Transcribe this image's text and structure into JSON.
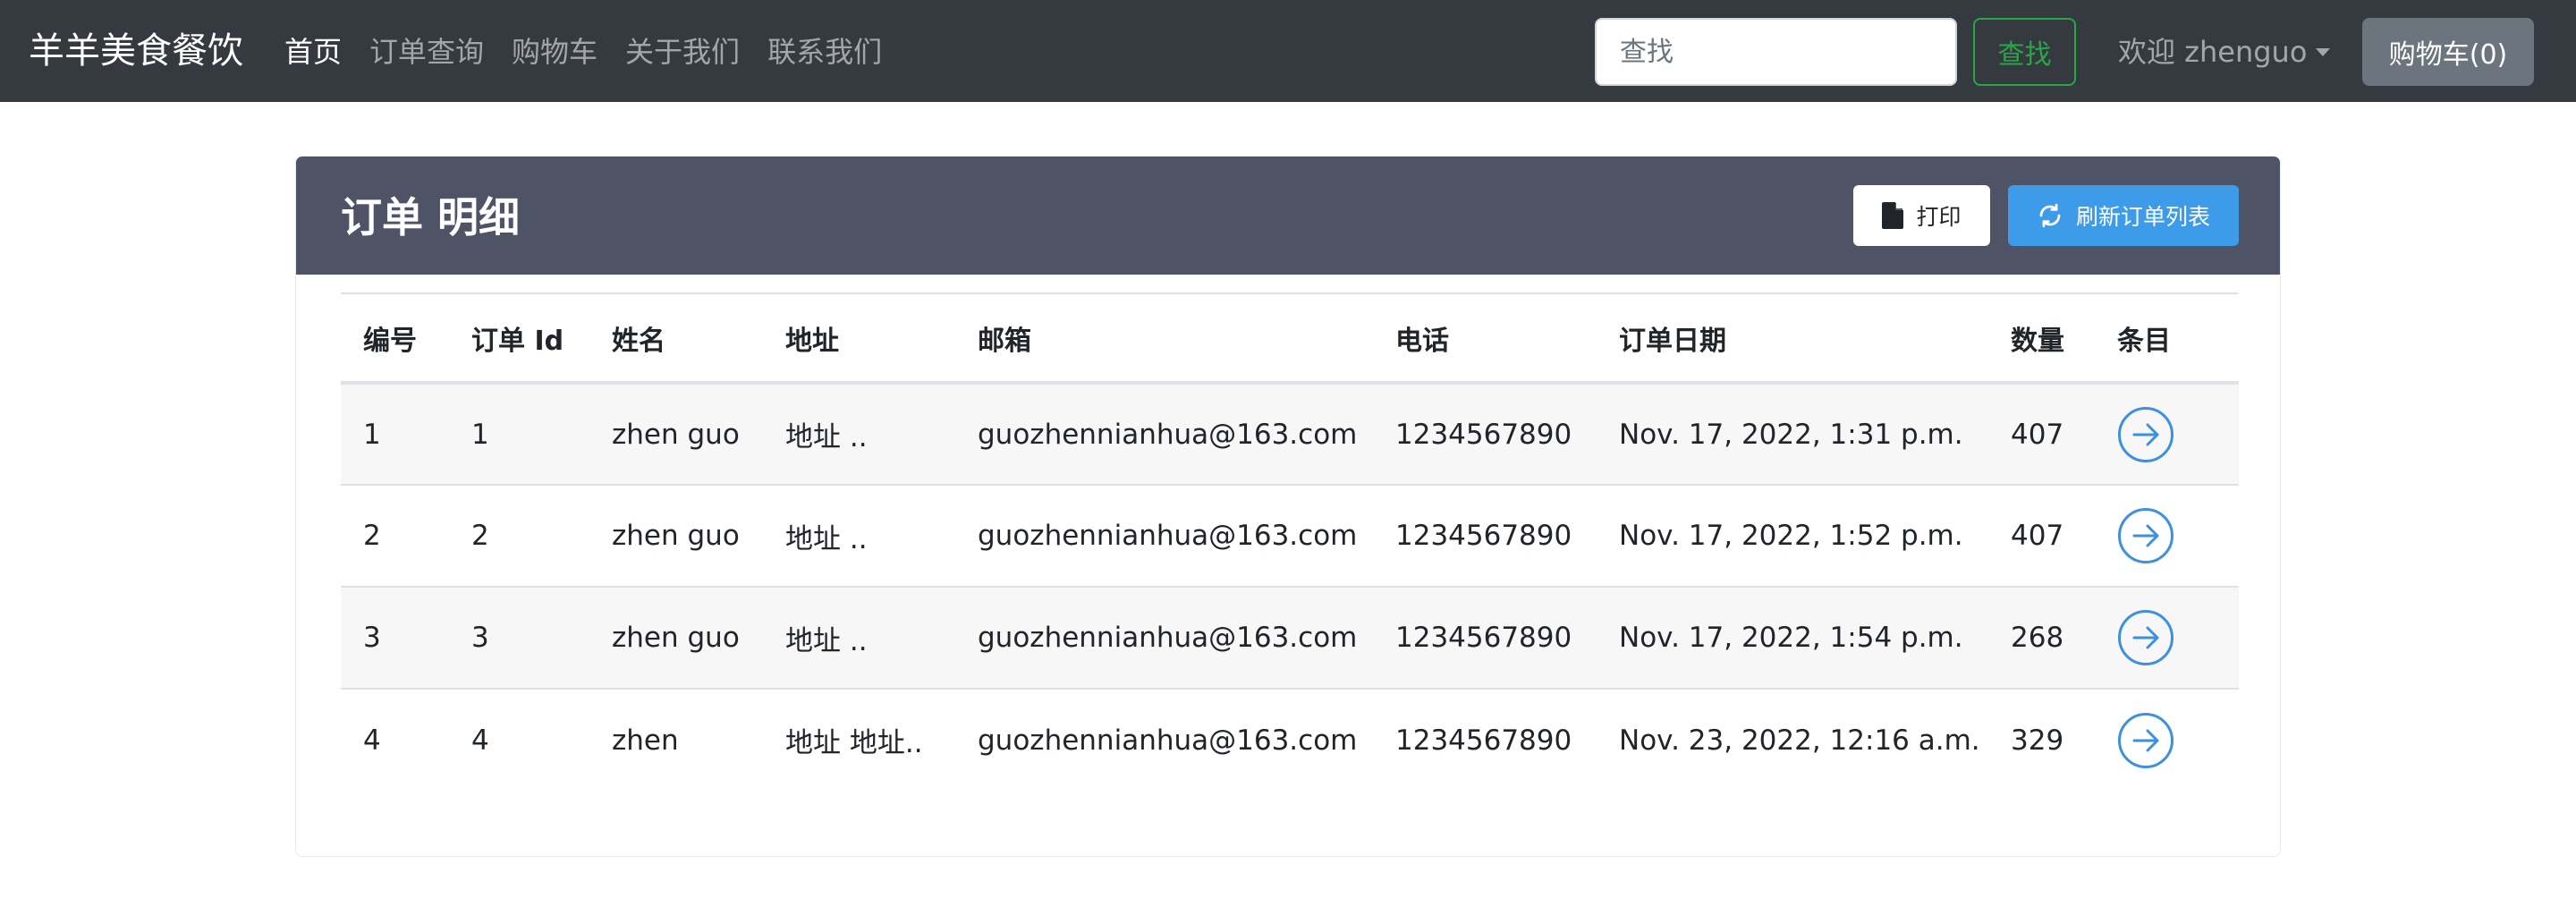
{
  "navbar": {
    "brand": "羊羊美食餐饮",
    "links": [
      {
        "label": "首页",
        "active": true
      },
      {
        "label": "订单查询",
        "active": false
      },
      {
        "label": "购物车",
        "active": false
      },
      {
        "label": "关于我们",
        "active": false
      },
      {
        "label": "联系我们",
        "active": false
      }
    ],
    "search_placeholder": "查找",
    "search_button": "查找",
    "user_label": "欢迎 zhenguo",
    "cart_button": "购物车(0)"
  },
  "card": {
    "title": "订单 明细",
    "print_button": "打印",
    "refresh_button": "刷新订单列表"
  },
  "table": {
    "headers": [
      "编号",
      "订单 Id",
      "姓名",
      "地址",
      "邮箱",
      "电话",
      "订单日期",
      "数量",
      "条目"
    ],
    "rows": [
      {
        "num": "1",
        "order_id": "1",
        "name": "zhen guo",
        "address": "地址 ..",
        "email": "guozhennianhua@163.com",
        "phone": "1234567890",
        "date": "Nov. 17, 2022, 1:31 p.m.",
        "quantity": "407"
      },
      {
        "num": "2",
        "order_id": "2",
        "name": "zhen guo",
        "address": "地址 ..",
        "email": "guozhennianhua@163.com",
        "phone": "1234567890",
        "date": "Nov. 17, 2022, 1:52 p.m.",
        "quantity": "407"
      },
      {
        "num": "3",
        "order_id": "3",
        "name": "zhen guo",
        "address": "地址 ..",
        "email": "guozhennianhua@163.com",
        "phone": "1234567890",
        "date": "Nov. 17, 2022, 1:54 p.m.",
        "quantity": "268"
      },
      {
        "num": "4",
        "order_id": "4",
        "name": "zhen",
        "address": "地址 地址..",
        "email": "guozhennianhua@163.com",
        "phone": "1234567890",
        "date": "Nov. 23, 2022, 12:16 a.m.",
        "quantity": "329"
      }
    ]
  },
  "icons": {
    "print": "file-icon",
    "refresh": "refresh-icon",
    "row_detail": "arrow-right-circle-icon"
  },
  "colors": {
    "navbar_bg": "#343a40",
    "card_header_bg": "#4e5366",
    "search_button": "#28a745",
    "cart_button": "#6c757d",
    "refresh_button": "#3d9be9",
    "detail_icon": "#3d8fe0"
  }
}
